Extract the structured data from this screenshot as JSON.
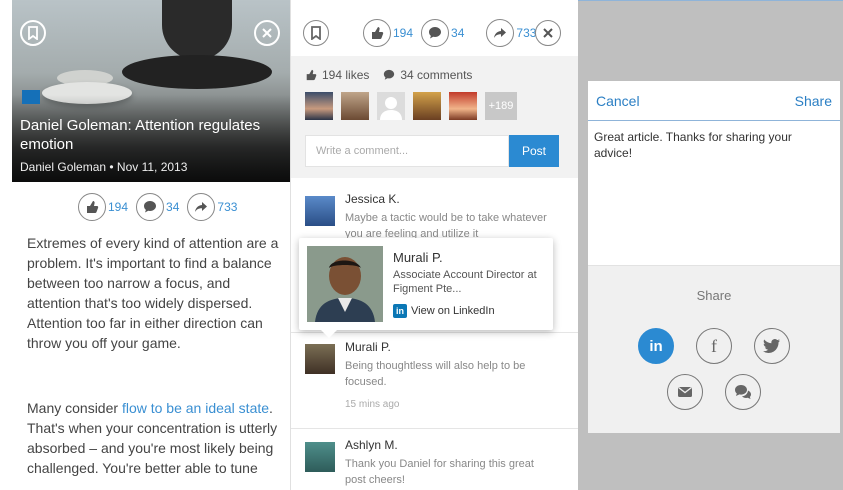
{
  "article": {
    "title": "Daniel Goleman: Attention regulates emotion",
    "meta": "Daniel Goleman • Nov 11, 2013",
    "source_badge": "",
    "paragraph1": "Extremes of every kind of attention are a problem. It's important to find a balance between too narrow a focus, and attention that's too widely dispersed. Attention too far in either direction can throw you off your game.",
    "paragraph2_start": "Many consider ",
    "paragraph2_link": "flow to be an ideal state",
    "paragraph2_end": ". That's when your concentration is utterly absorbed – and you're most likely being challenged. You're better able to tune"
  },
  "stats": {
    "likes": "194",
    "comments": "34",
    "shares": "733"
  },
  "social": {
    "likes_label": "194 likes",
    "comments_label": "34 comments",
    "more_avatars": "+189",
    "comment_placeholder": "Write a comment...",
    "post_label": "Post"
  },
  "comments": [
    {
      "name": "Jessica K.",
      "text": "Maybe a tactic would be to take whatever you are feeling and utilize it",
      "time": ""
    },
    {
      "name": "Murali P.",
      "text": "Being thoughtless will also help to be focused.",
      "time": "15 mins ago"
    },
    {
      "name": "Ashlyn M.",
      "text": "Thank you Daniel for sharing this great post cheers!",
      "time": ""
    }
  ],
  "profile_popup": {
    "name": "Murali P.",
    "title": "Associate Account Director at Figment Pte...",
    "view_label": "View on LinkedIn",
    "in_mark": "in"
  },
  "share_sheet": {
    "cancel_label": "Cancel",
    "share_label": "Share",
    "message": "Great article. Thanks for sharing your advice!",
    "footer_label": "Share",
    "linkedin_mark": "in",
    "facebook_mark": "f"
  },
  "colors": {
    "accent": "#2b8ad2",
    "link": "#3a8fd2",
    "linkedin": "#0b77b5"
  }
}
